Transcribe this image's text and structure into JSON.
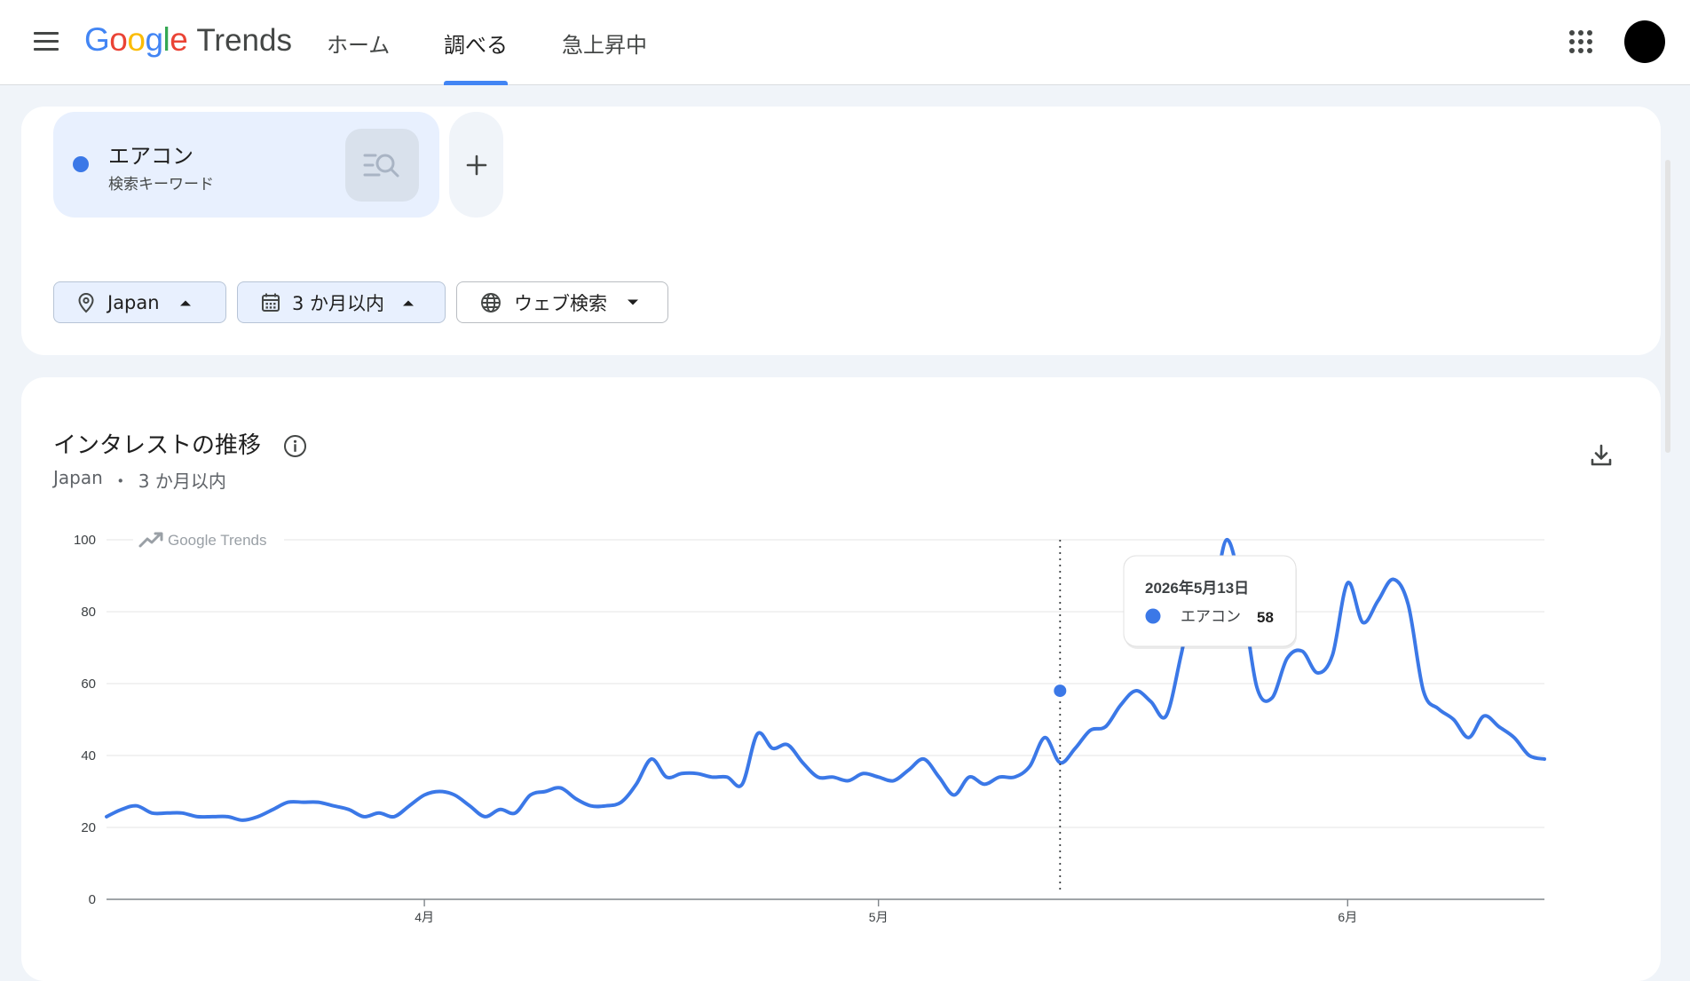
{
  "header": {
    "logo_google": "Google",
    "logo_trends": "Trends",
    "nav": [
      {
        "label": "ホーム"
      },
      {
        "label": "調べる"
      },
      {
        "label": "急上昇中"
      }
    ]
  },
  "search_term": {
    "name": "エアコン",
    "type": "検索キーワード",
    "color": "#3b78e7"
  },
  "filters": {
    "region": "Japan",
    "period": "3 か月以内",
    "property": "ウェブ検索"
  },
  "chart_section": {
    "title": "インタレストの推移",
    "region": "Japan",
    "separator": "・",
    "period": "3 か月以内",
    "watermark": "Google Trends"
  },
  "tooltip": {
    "date": "2026年5月13日",
    "term": "エアコン",
    "value": "58"
  },
  "chart_data": {
    "type": "line",
    "title": "インタレストの推移",
    "ylim": [
      0,
      100
    ],
    "yticks": [
      0,
      20,
      40,
      60,
      80,
      100
    ],
    "grid": true,
    "x_labels": [
      {
        "label": "4月",
        "date": "2026-04-01"
      },
      {
        "label": "5月",
        "date": "2026-05-01"
      },
      {
        "label": "6月",
        "date": "2026-06-01"
      }
    ],
    "x_start": "2026-03-11",
    "x_end": "2026-06-11",
    "highlight": {
      "date": "2026-05-13",
      "value": 58
    },
    "series": [
      {
        "name": "エアコン",
        "color": "#3b78e7",
        "points": [
          [
            "2026-03-11",
            23
          ],
          [
            "2026-03-12",
            25
          ],
          [
            "2026-03-13",
            26
          ],
          [
            "2026-03-14",
            24
          ],
          [
            "2026-03-15",
            24
          ],
          [
            "2026-03-16",
            24
          ],
          [
            "2026-03-17",
            23
          ],
          [
            "2026-03-18",
            23
          ],
          [
            "2026-03-19",
            23
          ],
          [
            "2026-03-20",
            22
          ],
          [
            "2026-03-21",
            23
          ],
          [
            "2026-03-22",
            25
          ],
          [
            "2026-03-23",
            27
          ],
          [
            "2026-03-24",
            27
          ],
          [
            "2026-03-25",
            27
          ],
          [
            "2026-03-26",
            26
          ],
          [
            "2026-03-27",
            25
          ],
          [
            "2026-03-28",
            23
          ],
          [
            "2026-03-29",
            24
          ],
          [
            "2026-03-30",
            23
          ],
          [
            "2026-03-31",
            26
          ],
          [
            "2026-04-01",
            29
          ],
          [
            "2026-04-02",
            30
          ],
          [
            "2026-04-03",
            29
          ],
          [
            "2026-04-04",
            26
          ],
          [
            "2026-04-05",
            23
          ],
          [
            "2026-04-06",
            25
          ],
          [
            "2026-04-07",
            24
          ],
          [
            "2026-04-08",
            29
          ],
          [
            "2026-04-09",
            30
          ],
          [
            "2026-04-10",
            31
          ],
          [
            "2026-04-11",
            28
          ],
          [
            "2026-04-12",
            26
          ],
          [
            "2026-04-13",
            26
          ],
          [
            "2026-04-14",
            27
          ],
          [
            "2026-04-15",
            32
          ],
          [
            "2026-04-16",
            39
          ],
          [
            "2026-04-17",
            34
          ],
          [
            "2026-04-18",
            35
          ],
          [
            "2026-04-19",
            35
          ],
          [
            "2026-04-20",
            34
          ],
          [
            "2026-04-21",
            34
          ],
          [
            "2026-04-22",
            32
          ],
          [
            "2026-04-23",
            46
          ],
          [
            "2026-04-24",
            42
          ],
          [
            "2026-04-25",
            43
          ],
          [
            "2026-04-26",
            38
          ],
          [
            "2026-04-27",
            34
          ],
          [
            "2026-04-28",
            34
          ],
          [
            "2026-04-29",
            33
          ],
          [
            "2026-04-30",
            35
          ],
          [
            "2026-05-01",
            34
          ],
          [
            "2026-05-02",
            33
          ],
          [
            "2026-05-03",
            36
          ],
          [
            "2026-05-04",
            39
          ],
          [
            "2026-05-05",
            34
          ],
          [
            "2026-05-06",
            29
          ],
          [
            "2026-05-07",
            34
          ],
          [
            "2026-05-08",
            32
          ],
          [
            "2026-05-09",
            34
          ],
          [
            "2026-05-10",
            34
          ],
          [
            "2026-05-11",
            37
          ],
          [
            "2026-05-12",
            45
          ],
          [
            "2026-05-13",
            38
          ],
          [
            "2026-05-14",
            42
          ],
          [
            "2026-05-15",
            47
          ],
          [
            "2026-05-16",
            48
          ],
          [
            "2026-05-17",
            54
          ],
          [
            "2026-05-18",
            58
          ],
          [
            "2026-05-19",
            55
          ],
          [
            "2026-05-20",
            51
          ],
          [
            "2026-05-21",
            68
          ],
          [
            "2026-05-22",
            87
          ],
          [
            "2026-05-23",
            82
          ],
          [
            "2026-05-24",
            100
          ],
          [
            "2026-05-25",
            85
          ],
          [
            "2026-05-26",
            59
          ],
          [
            "2026-05-27",
            56
          ],
          [
            "2026-05-28",
            67
          ],
          [
            "2026-05-29",
            69
          ],
          [
            "2026-05-30",
            63
          ],
          [
            "2026-05-31",
            68
          ],
          [
            "2026-06-01",
            88
          ],
          [
            "2026-06-02",
            77
          ],
          [
            "2026-06-03",
            83
          ],
          [
            "2026-06-04",
            89
          ],
          [
            "2026-06-05",
            82
          ],
          [
            "2026-06-06",
            58
          ],
          [
            "2026-06-07",
            53
          ],
          [
            "2026-06-08",
            50
          ],
          [
            "2026-06-09",
            45
          ],
          [
            "2026-06-10",
            51
          ],
          [
            "2026-06-11",
            48
          ],
          [
            "2026-06-12",
            45
          ],
          [
            "2026-06-13",
            40
          ],
          [
            "2026-06-14",
            39
          ]
        ]
      }
    ]
  }
}
